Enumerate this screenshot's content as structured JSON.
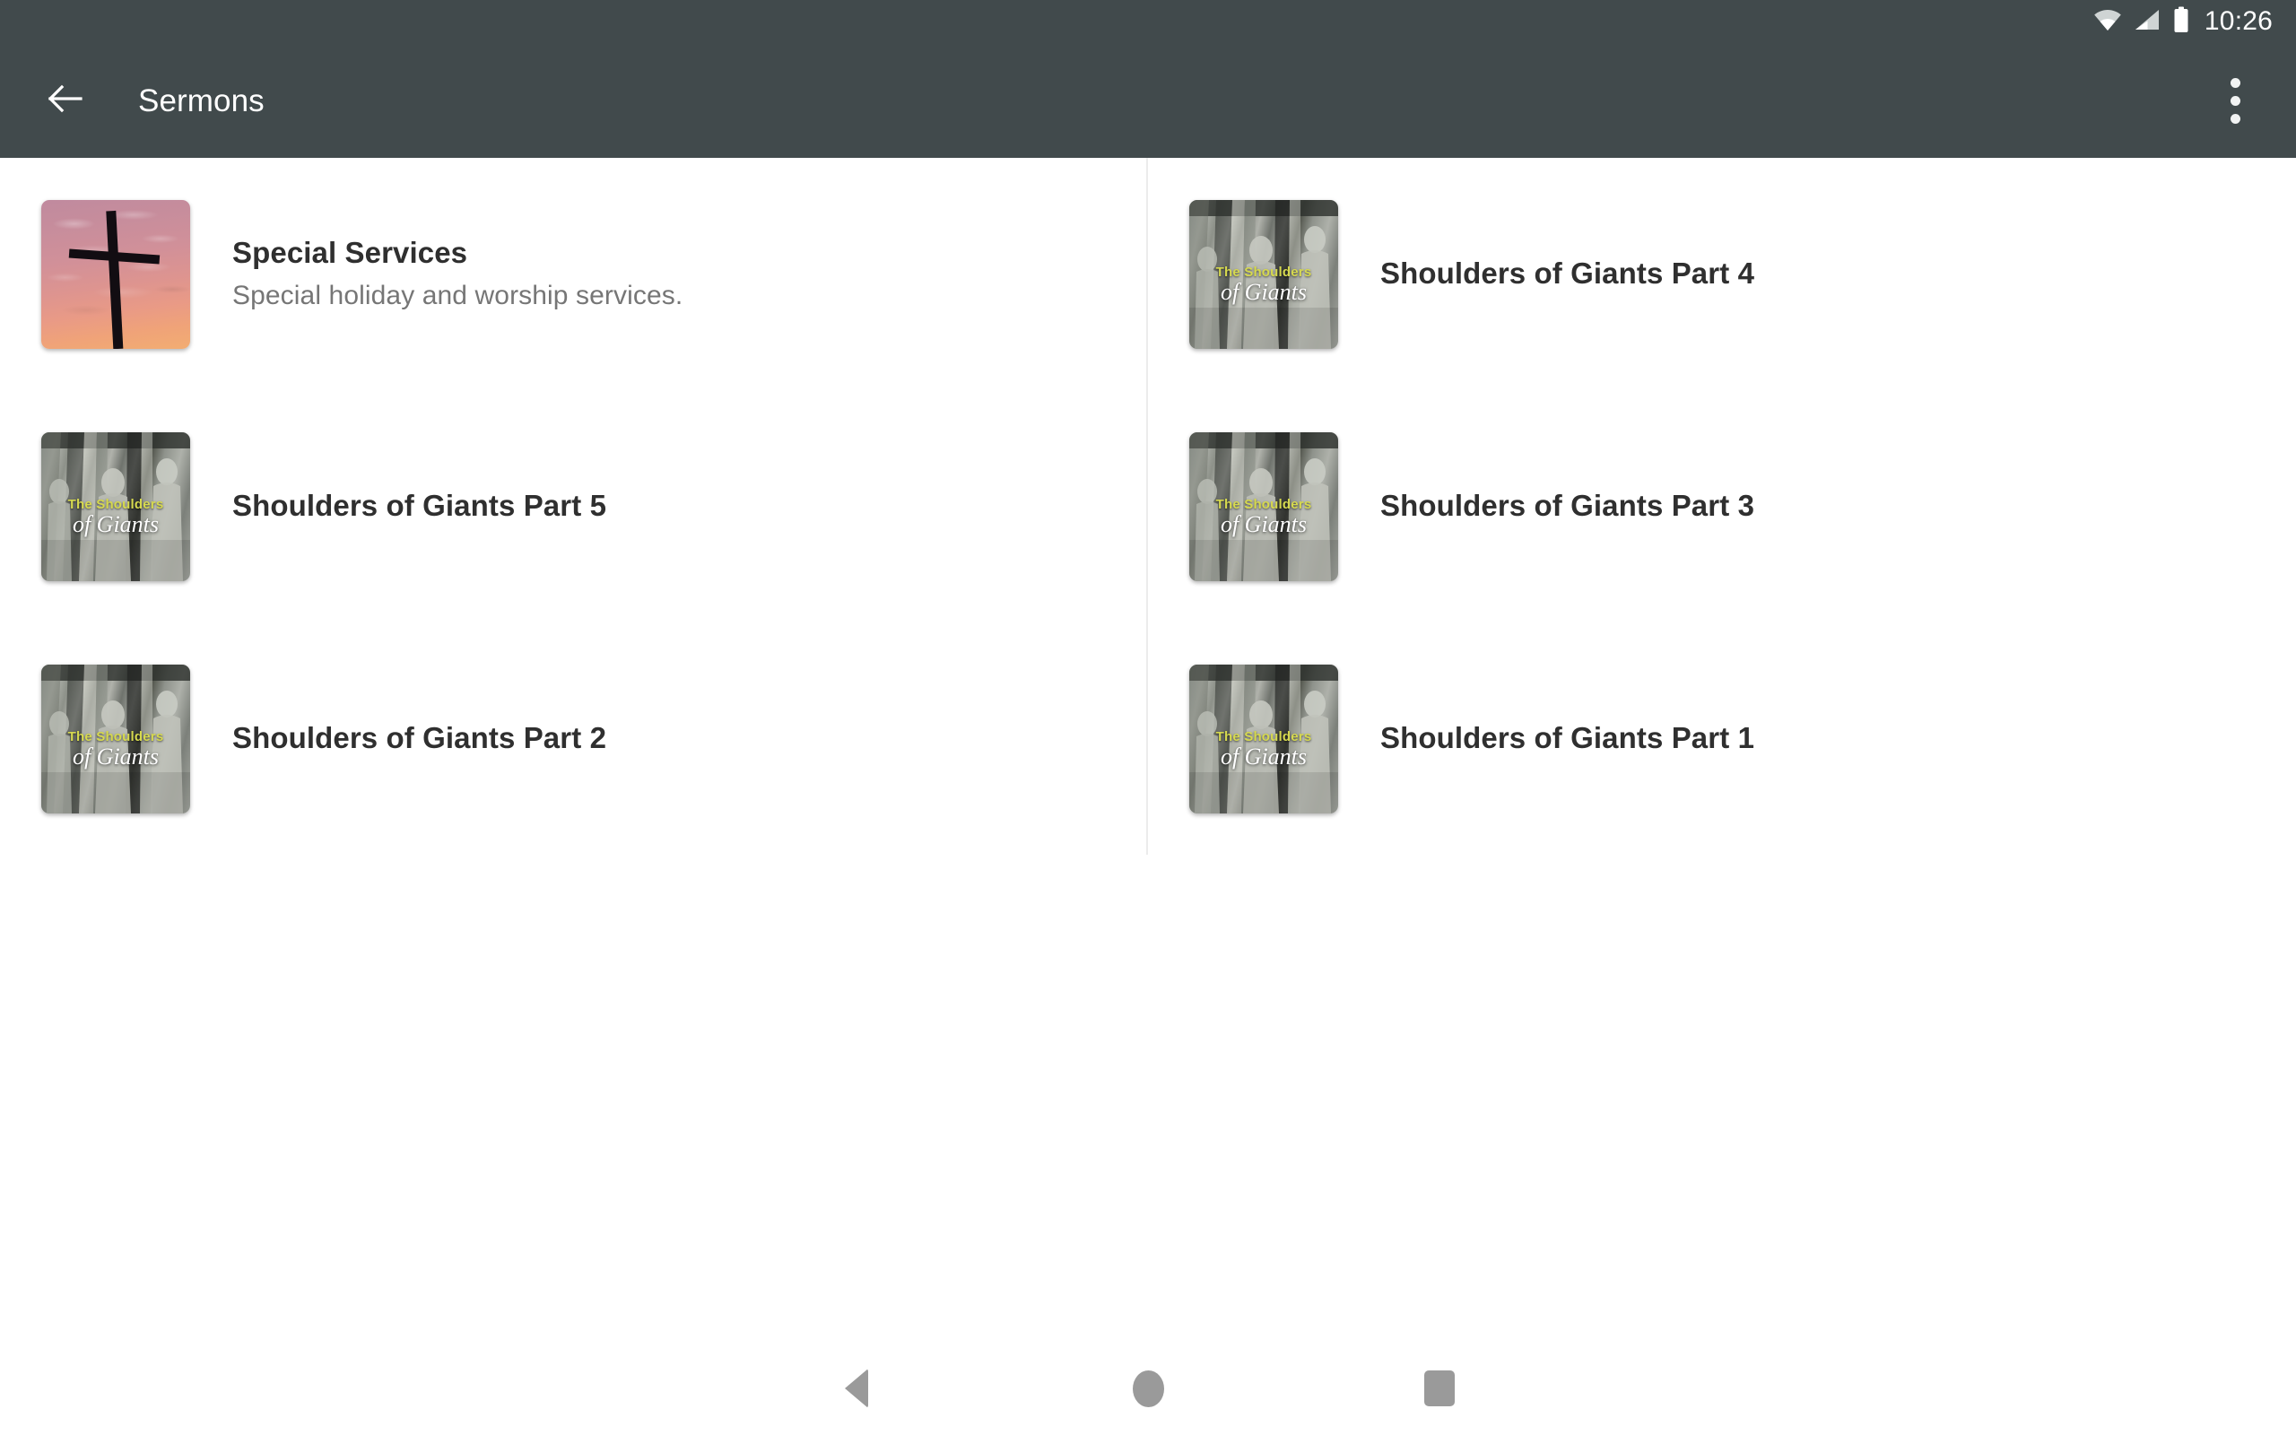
{
  "status_bar": {
    "time": "10:26",
    "icons": [
      "wifi-icon",
      "cellular-signal-icon",
      "battery-icon"
    ],
    "background_color": "#414a4c"
  },
  "toolbar": {
    "back_icon": "back-arrow-icon",
    "title": "Sermons",
    "overflow_icon": "overflow-menu-icon",
    "background_color": "#414a4c",
    "title_color": "#ffffff"
  },
  "list": {
    "divider_color": "#ececec",
    "columns": 2,
    "items": [
      {
        "title": "Special Services",
        "subtitle": "Special holiday and worship services.",
        "thumbnail": "cross-sunset-thumbnail",
        "thumbnail_kind": "cross",
        "column": "left",
        "row": 1
      },
      {
        "title": "Shoulders of Giants Part 4",
        "subtitle": "",
        "thumbnail": "shoulders-of-giants-thumbnail",
        "thumbnail_kind": "giants",
        "column": "right",
        "row": 1
      },
      {
        "title": "Shoulders of Giants Part 5",
        "subtitle": "",
        "thumbnail": "shoulders-of-giants-thumbnail",
        "thumbnail_kind": "giants",
        "column": "left",
        "row": 2
      },
      {
        "title": "Shoulders of Giants Part 3",
        "subtitle": "",
        "thumbnail": "shoulders-of-giants-thumbnail",
        "thumbnail_kind": "giants",
        "column": "right",
        "row": 2
      },
      {
        "title": "Shoulders of Giants Part 2",
        "subtitle": "",
        "thumbnail": "shoulders-of-giants-thumbnail",
        "thumbnail_kind": "giants",
        "column": "left",
        "row": 3
      },
      {
        "title": "Shoulders of Giants Part 1",
        "subtitle": "",
        "thumbnail": "shoulders-of-giants-thumbnail",
        "thumbnail_kind": "giants",
        "column": "right",
        "row": 3
      }
    ],
    "thumbnail_artwork": {
      "giants_line1": "The Shoulders",
      "giants_line2": "of Giants",
      "giants_line1_color": "#d6d94f",
      "giants_line2_color": "#ffffff"
    }
  },
  "nav_bar": {
    "buttons": [
      {
        "name": "back-nav-button",
        "icon": "triangle-back-icon"
      },
      {
        "name": "home-nav-button",
        "icon": "circle-home-icon"
      },
      {
        "name": "recents-nav-button",
        "icon": "square-recents-icon"
      }
    ],
    "icon_color": "#9a9a9a",
    "background_color": "#ffffff"
  }
}
